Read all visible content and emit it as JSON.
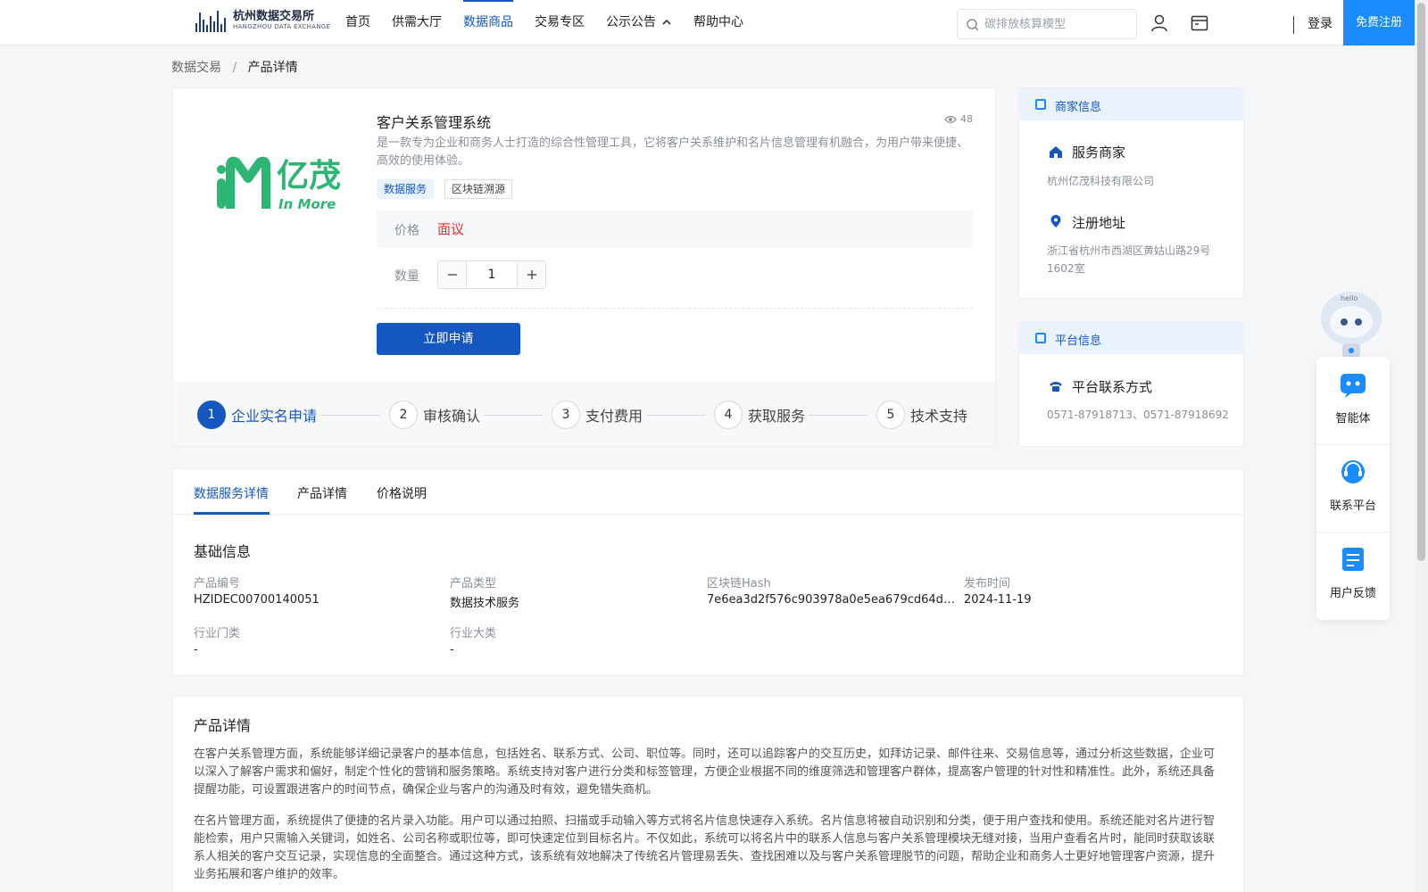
{
  "header": {
    "logo_cn": "杭州数据交易所",
    "logo_en": "HANGZHOU DATA EXCHANGE",
    "nav": [
      "首页",
      "供需大厅",
      "数据商品",
      "交易专区",
      "公示公告",
      "帮助中心"
    ],
    "active_nav": "数据商品",
    "search_placeholder": "碳排放核算模型",
    "login": "登录",
    "register": "免费注册"
  },
  "breadcrumb": {
    "root": "数据交易",
    "sep": "/",
    "current": "产品详情"
  },
  "product": {
    "logo_cn": "亿茂",
    "logo_en": "In More",
    "title": "客户关系管理系统",
    "views": "48",
    "description": "是一款专为企业和商务人士打造的综合性管理工具，它将客户关系维护和名片信息管理有机融合，为用户带来便捷、高效的使用体验。",
    "tags": [
      "数据服务",
      "区块链溯源"
    ],
    "price_label": "价格",
    "price_value": "面议",
    "qty_label": "数量",
    "qty_value": "1",
    "apply_label": "立即申请"
  },
  "steps": [
    {
      "num": "1",
      "label": "企业实名申请"
    },
    {
      "num": "2",
      "label": "审核确认"
    },
    {
      "num": "3",
      "label": "支付费用"
    },
    {
      "num": "4",
      "label": "获取服务"
    },
    {
      "num": "5",
      "label": "技术支持"
    }
  ],
  "merchant": {
    "head": "商家信息",
    "service_label": "服务商家",
    "service_value": "杭州亿茂科技有限公司",
    "addr_label": "注册地址",
    "addr_value": "浙江省杭州市西湖区黄姑山路29号1602室"
  },
  "platform": {
    "head": "平台信息",
    "contact_label": "平台联系方式",
    "contact_value": "0571-87918713、0571-87918692"
  },
  "float": {
    "robot_text": "hello",
    "agent": "智能体",
    "contact": "联系平台",
    "feedback": "用户反馈"
  },
  "tabs": [
    "数据服务详情",
    "产品详情",
    "价格说明"
  ],
  "basic": {
    "title": "基础信息",
    "fields": [
      {
        "label": "产品编号",
        "value": "HZIDEC00700140051"
      },
      {
        "label": "产品类型",
        "value": "数据技术服务"
      },
      {
        "label": "区块链Hash",
        "value": "7e6ea3d2f576c903978a0e5ea679cd64dfc..."
      },
      {
        "label": "发布时间",
        "value": "2024-11-19"
      },
      {
        "label": "行业门类",
        "value": "-"
      },
      {
        "label": "行业大类",
        "value": "-"
      }
    ]
  },
  "detail": {
    "title": "产品详情",
    "p1": "在客户关系管理方面，系统能够详细记录客户的基本信息，包括姓名、联系方式、公司、职位等。同时，还可以追踪客户的交互历史，如拜访记录、邮件往来、交易信息等，通过分析这些数据，企业可以深入了解客户需求和偏好，制定个性化的营销和服务策略。系统支持对客户进行分类和标签管理，方便企业根据不同的维度筛选和管理客户群体，提高客户管理的针对性和精准性。此外，系统还具备提醒功能，可设置跟进客户的时间节点，确保企业与客户的沟通及时有效，避免错失商机。",
    "p2": "在名片管理方面，系统提供了便捷的名片录入功能。用户可以通过拍照、扫描或手动输入等方式将名片信息快速存入系统。名片信息将被自动识别和分类，便于用户查找和使用。系统还能对名片进行智能检索，用户只需输入关键词，如姓名、公司名称或职位等，即可快速定位到目标名片。不仅如此，系统可以将名片中的联系人信息与客户关系管理模块无缝对接，当用户查看名片时，能同时获取该联系人相关的客户交互记录，实现信息的全面整合。通过这种方式，该系统有效地解决了传统名片管理易丢失、查找困难以及与客户关系管理脱节的问题，帮助企业和商务人士更好地管理客户资源，提升业务拓展和客户维护的效率。"
  },
  "colors": {
    "primary": "#1557c0",
    "accent": "#1a8cff",
    "price": "#e0312a",
    "logo_green": "#2bb673"
  }
}
